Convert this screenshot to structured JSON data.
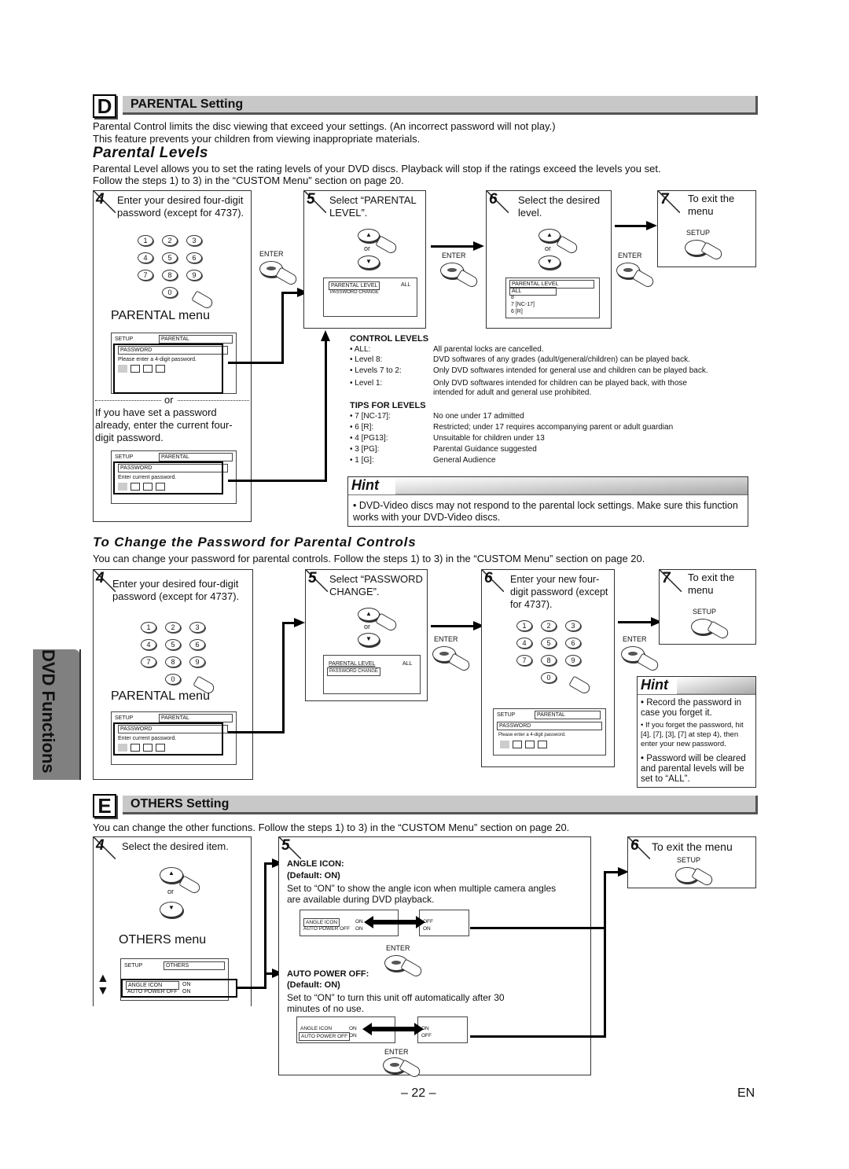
{
  "side_tab": "DVD Functions",
  "section_d": {
    "letter": "D",
    "title": "PARENTAL Setting",
    "intro_1": "Parental Control limits the disc viewing that exceed your settings. (An incorrect password will not play.)",
    "intro_2": "This feature prevents your children from viewing inappropriate materials."
  },
  "parental_levels": {
    "heading": "Parental Levels",
    "desc_1": "Parental Level allows you to set the rating levels of your DVD discs. Playback will stop if the ratings exceed the levels you set.",
    "desc_2": "Follow the steps 1) to 3) in the “CUSTOM Menu” section on page 20.",
    "step4": {
      "num": "4",
      "text": "Enter your desired four-digit password (except for 4737).",
      "menu_label": "PARENTAL menu",
      "screen_a": {
        "setup": "SETUP",
        "tab": "PARENTAL",
        "field": "PASSWORD",
        "prompt": "Please enter a 4-digit password."
      },
      "or": "or",
      "alt_text": "If you have set a password already, enter the current four-digit password.",
      "screen_b": {
        "setup": "SETUP",
        "tab": "PARENTAL",
        "field": "PASSWORD",
        "prompt": "Enter current password."
      }
    },
    "step5": {
      "num": "5",
      "text": "Select “PARENTAL LEVEL”.",
      "or": "or",
      "screen": {
        "item1": "PARENTAL LEVEL",
        "item1_value": "ALL",
        "item2": "PASSWORD CHANGE"
      }
    },
    "step6": {
      "num": "6",
      "text": "Select the desired level.",
      "or": "or",
      "screen": {
        "title": "PARENTAL LEVEL",
        "options": [
          "ALL",
          "8",
          "7 [NC-17]",
          "6 [R]"
        ]
      }
    },
    "step7": {
      "num": "7",
      "text": "To exit the menu",
      "button": "SETUP"
    },
    "enter_label": "ENTER",
    "keypad": [
      "1",
      "2",
      "3",
      "4",
      "5",
      "6",
      "7",
      "8",
      "9",
      "0"
    ],
    "control_levels": {
      "title": "CONTROL LEVELS",
      "rows": [
        {
          "k": "• ALL:",
          "v": "All parental locks are cancelled."
        },
        {
          "k": "• Level 8:",
          "v": "DVD softwares of any grades (adult/general/children) can be played back."
        },
        {
          "k": "• Levels 7 to 2:",
          "v": "Only DVD softwares intended for general use and children can be played back."
        },
        {
          "k": "• Level 1:",
          "v": "Only DVD softwares intended for children can be played back, with those intended for adult and general use prohibited."
        }
      ]
    },
    "tips_for_levels": {
      "title": "TIPS FOR LEVELS",
      "rows": [
        {
          "k": "• 7 [NC-17]:",
          "v": "No one under 17 admitted"
        },
        {
          "k": "• 6 [R]:",
          "v": "Restricted; under 17 requires accompanying parent or adult guardian"
        },
        {
          "k": "• 4 [PG13]:",
          "v": "Unsuitable for children under 13"
        },
        {
          "k": "• 3 [PG]:",
          "v": "Parental Guidance suggested"
        },
        {
          "k": "• 1 [G]:",
          "v": "General Audience"
        }
      ]
    },
    "hint": {
      "title": "Hint",
      "text": "• DVD-Video discs may not respond to the parental lock settings. Make sure this function works with your DVD-Video discs."
    }
  },
  "change_password": {
    "heading": "To Change the Password for Parental Controls",
    "desc": "You can change your password for parental controls.  Follow the steps 1) to 3) in the “CUSTOM Menu” section on page 20.",
    "step4": {
      "num": "4",
      "text": "Enter your desired four-digit password (except for 4737).",
      "menu_label": "PARENTAL menu",
      "screen": {
        "setup": "SETUP",
        "tab": "PARENTAL",
        "field": "PASSWORD",
        "prompt": "Enter current password."
      }
    },
    "step5": {
      "num": "5",
      "text": "Select “PASSWORD CHANGE”.",
      "or": "or",
      "screen": {
        "item1": "PARENTAL LEVEL",
        "item1_value": "ALL",
        "item2": "PASSWORD CHANGE"
      }
    },
    "step6": {
      "num": "6",
      "text": "Enter your new four-digit password (except for 4737).",
      "screen": {
        "setup": "SETUP",
        "tab": "PARENTAL",
        "field": "PASSWORD",
        "prompt": "Please enter a 4-digit password."
      }
    },
    "step7": {
      "num": "7",
      "text": "To exit the menu",
      "button": "SETUP"
    },
    "enter_label": "ENTER",
    "hint": {
      "title": "Hint",
      "items": [
        "• Record the password in case you forget it.",
        "• If you forget the password, hit [4], [7], [3], [7] at step 4), then enter your new password.",
        "• Password will be cleared and parental levels will be set to “ALL”."
      ]
    }
  },
  "section_e": {
    "letter": "E",
    "title": "OTHERS Setting",
    "intro": "You can change the other functions. Follow the steps 1) to 3) in the “CUSTOM Menu” section on page 20.",
    "step4": {
      "num": "4",
      "text": "Select the desired item.",
      "or": "or",
      "menu_label": "OTHERS menu",
      "screen": {
        "setup": "SETUP",
        "tab": "OTHERS",
        "item1": "ANGLE ICON",
        "item1_value": "ON",
        "item2": "AUTO POWER OFF",
        "item2_value": "ON"
      }
    },
    "step5": {
      "num": "5",
      "angle_icon": {
        "title": "ANGLE ICON:",
        "default": "(Default: ON)",
        "desc": "Set to “ON” to show the angle icon when multiple camera angles are available during DVD playback.",
        "screen": {
          "item1": "ANGLE ICON",
          "item1_value": "ON",
          "item2": "AUTO POWER OFF",
          "item2_value": "ON",
          "opt1": "OFF",
          "opt2": "ON"
        }
      },
      "auto_power_off": {
        "title": "AUTO POWER OFF:",
        "default": "(Default: ON)",
        "desc": "Set to “ON” to turn this unit off automatically after 30 minutes of no use.",
        "screen": {
          "item1": "ANGLE ICON",
          "item1_value": "ON",
          "item2": "AUTO POWER OFF",
          "item2_value": "ON",
          "opt1": "ON",
          "opt2": "OFF"
        }
      },
      "enter_label": "ENTER"
    },
    "step6": {
      "num": "6",
      "text": "To exit the menu",
      "button": "SETUP"
    }
  },
  "footer": {
    "page": "– 22 –",
    "lang": "EN"
  }
}
